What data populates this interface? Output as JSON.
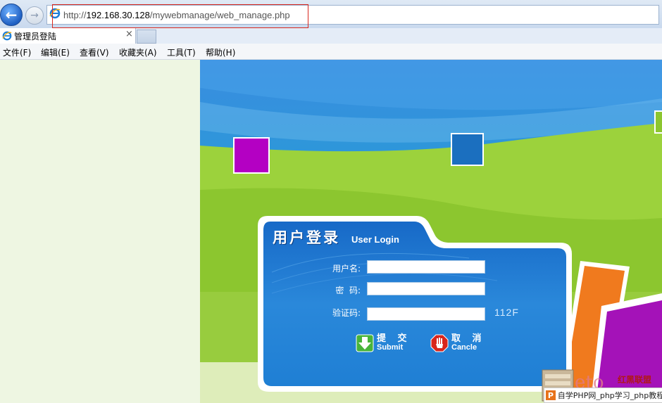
{
  "browser": {
    "url_prefix": "http://",
    "url_host": "192.168.30.128",
    "url_path": "/mywebmanage/web_manage.php",
    "tab_title": "管理员登陆",
    "tab_close": "×",
    "back_glyph": "←",
    "forward_glyph": "→"
  },
  "menu": [
    {
      "label": "文件(F)"
    },
    {
      "label": "编辑(E)"
    },
    {
      "label": "查看(V)"
    },
    {
      "label": "收藏夹(A)"
    },
    {
      "label": "工具(T)"
    },
    {
      "label": "帮助(H)"
    }
  ],
  "login": {
    "title_cn": "用户登录",
    "title_en": "User Login",
    "username_label": "用户名:",
    "password_label": "密  码:",
    "captcha_label": "验证码:",
    "username_value": "",
    "password_value": "",
    "captcha_value": "",
    "captcha_code": "112F",
    "submit_cn": "提 交",
    "submit_en": "Submit",
    "cancel_cn": "取 消",
    "cancel_en": "Cancle"
  },
  "watermark": {
    "text": "自学PHP网_php学习_php教程",
    "badge": "P",
    "red_text": "红黑联盟"
  },
  "colors": {
    "accent": "#2f8fdc",
    "panel_blue": "#1e7fd6",
    "left_frame_bg": "#eef6e2",
    "square_purple": "#b400c3",
    "square_blue": "#1b6fbf",
    "fan_orange": "#f07a1e",
    "fan_purple": "#a412b8"
  },
  "icons": {
    "back": "back-arrow-icon",
    "forward": "forward-arrow-icon",
    "ie": "ie-logo-icon",
    "submit": "green-down-arrow-icon",
    "cancel": "red-stop-hand-icon"
  }
}
